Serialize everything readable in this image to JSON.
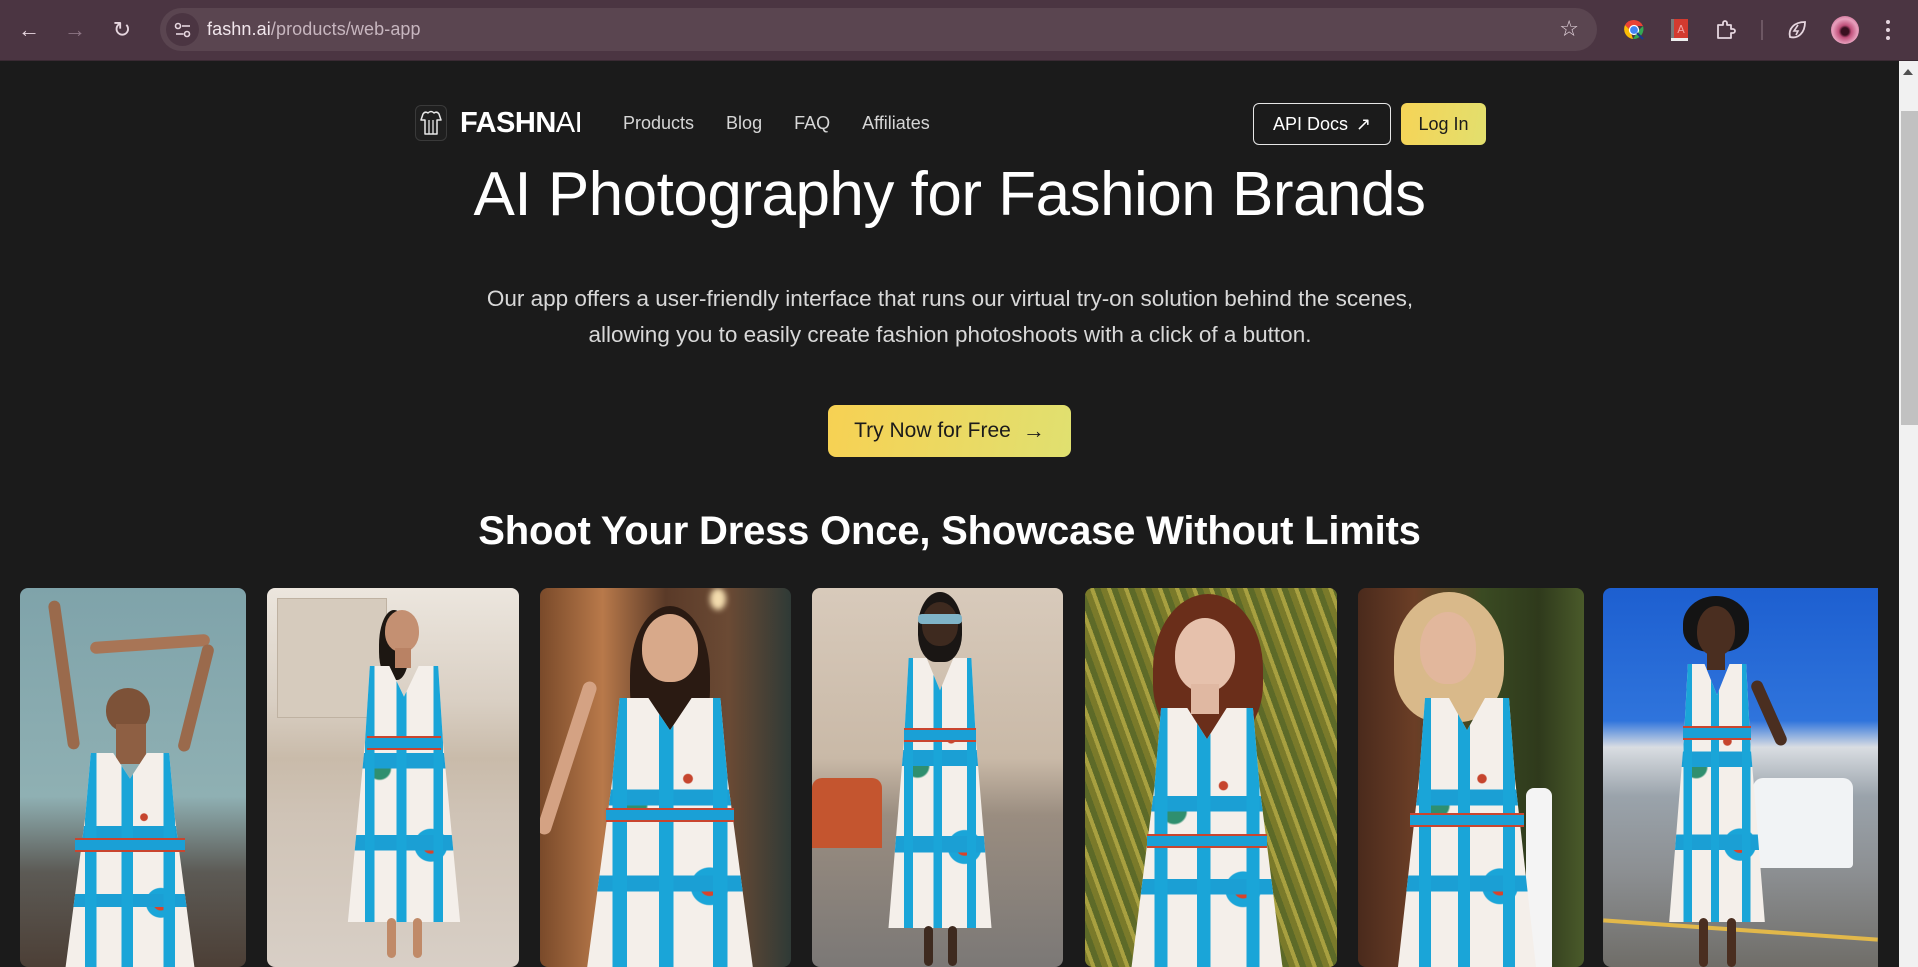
{
  "browser": {
    "url_host": "fashn.ai",
    "url_path": "/products/web-app",
    "icons": {
      "back": "arrow-left-icon",
      "forward": "arrow-right-icon",
      "reload": "reload-icon",
      "site_info": "tune-icon",
      "bookmark": "star-icon",
      "extensions": [
        "chrome-lens-extension-icon",
        "red-book-extension-icon",
        "puzzle-extensions-icon",
        "leaf-bolt-icon"
      ],
      "profile": "profile-avatar",
      "menu": "kebab-menu-icon"
    },
    "back_glyph": "←",
    "forward_glyph": "→",
    "reload_glyph": "↻",
    "star_glyph": "☆"
  },
  "site": {
    "logo": {
      "bold": "FASHN",
      "light": "AI"
    },
    "nav": [
      "Products",
      "Blog",
      "FAQ",
      "Affiliates"
    ],
    "api_docs_label": "API Docs",
    "api_docs_arrow": "↗",
    "login_label": "Log In",
    "accent_color": "#f5d45a"
  },
  "hero": {
    "title": "AI Photography for Fashion Brands",
    "subtitle": "Our app offers a user-friendly interface that runs our virtual try-on solution behind the scenes, allowing you to easily create fashion photoshoots with a click of a button.",
    "cta_label": "Try Now for Free",
    "cta_arrow": "→"
  },
  "gallery": {
    "title": "Shoot Your Dress Once, Showcase Without Limits",
    "photos": [
      {
        "alt": "Model with arms raised against teal sky wearing patterned dress"
      },
      {
        "alt": "Model on rooftop terrace wearing long patterned dress"
      },
      {
        "alt": "Model in warm-lit indoor setting wearing patterned dress"
      },
      {
        "alt": "Model with braids and sunglasses on city street wearing patterned dress"
      },
      {
        "alt": "Red-haired model in bamboo greenery wearing patterned dress"
      },
      {
        "alt": "Blonde model outdoors wearing patterned dress"
      },
      {
        "alt": "Model under blue sky near parked vans wearing patterned dress"
      }
    ]
  }
}
